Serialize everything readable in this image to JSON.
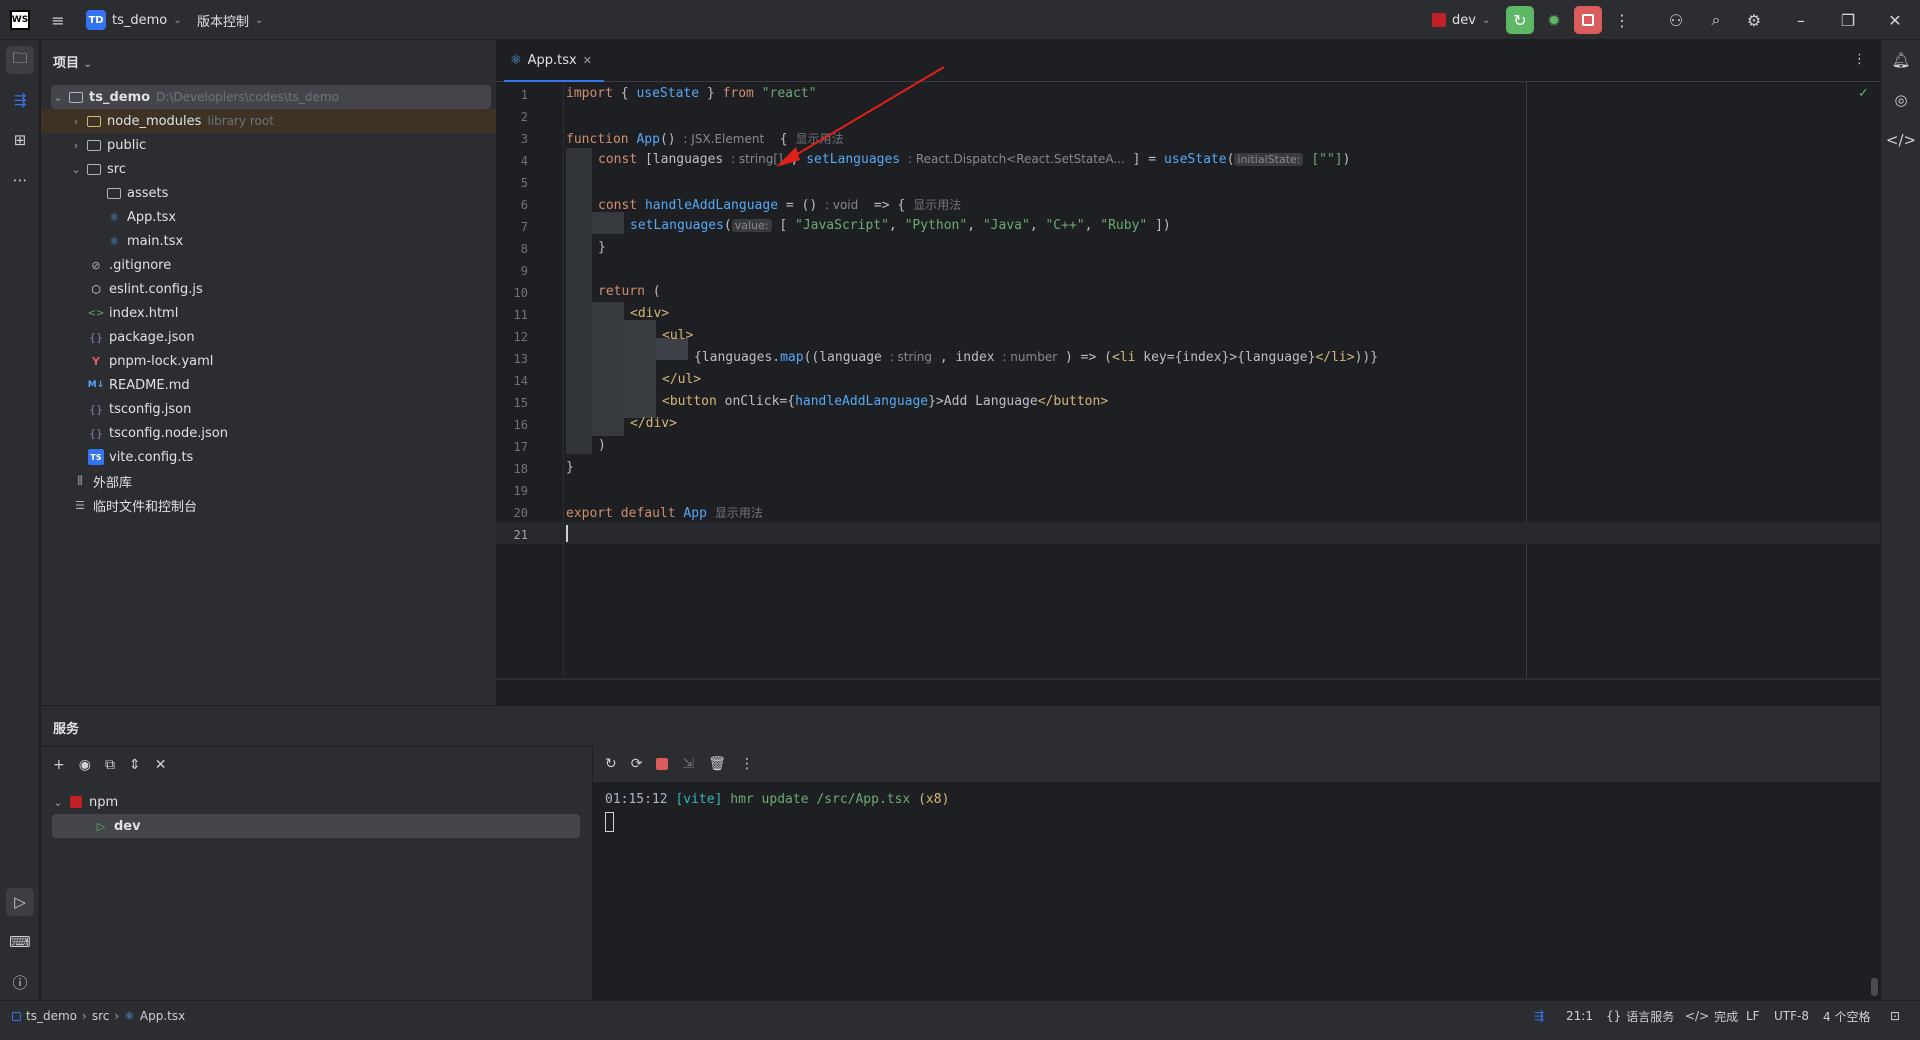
{
  "titlebar": {
    "logo": "WS",
    "menu_icon": "hamburger-icon",
    "project_badge": "TD",
    "project_name": "ts_demo",
    "vcs_label": "版本控制",
    "run_config": "dev"
  },
  "project_panel": {
    "title": "项目",
    "tree": [
      {
        "label": "ts_demo",
        "hint": "D:\\Developlers\\codes\\ts_demo",
        "icon": "folder-icon"
      },
      {
        "label": "node_modules",
        "hint": "library root",
        "icon": "folder-icon"
      },
      {
        "label": "public",
        "hint": "",
        "icon": "folder-icon"
      },
      {
        "label": "src",
        "hint": "",
        "icon": "folder-icon"
      },
      {
        "label": "assets",
        "hint": "",
        "icon": "folder-icon"
      },
      {
        "label": "App.tsx",
        "hint": "",
        "icon": "react-icon"
      },
      {
        "label": "main.tsx",
        "hint": "",
        "icon": "react-icon"
      },
      {
        "label": ".gitignore",
        "hint": "",
        "icon": "ignore-icon"
      },
      {
        "label": "eslint.config.js",
        "hint": "",
        "icon": "eslint-icon"
      },
      {
        "label": "index.html",
        "hint": "",
        "icon": "html-icon"
      },
      {
        "label": "package.json",
        "hint": "",
        "icon": "json-icon"
      },
      {
        "label": "pnpm-lock.yaml",
        "hint": "",
        "icon": "yaml-icon"
      },
      {
        "label": "README.md",
        "hint": "",
        "icon": "markdown-icon"
      },
      {
        "label": "tsconfig.json",
        "hint": "",
        "icon": "json-icon"
      },
      {
        "label": "tsconfig.node.json",
        "hint": "",
        "icon": "json-icon"
      },
      {
        "label": "vite.config.ts",
        "hint": "",
        "icon": "typescript-icon"
      },
      {
        "label": "外部库",
        "hint": "",
        "icon": "library-icon"
      },
      {
        "label": "临时文件和控制台",
        "hint": "",
        "icon": "scratch-icon"
      }
    ]
  },
  "editor": {
    "tab_label": "App.tsx",
    "line_numbers": [
      "1",
      "2",
      "3",
      "4",
      "5",
      "6",
      "7",
      "8",
      "9",
      "10",
      "11",
      "12",
      "13",
      "14",
      "15",
      "16",
      "17",
      "18",
      "19",
      "20",
      "21"
    ],
    "usage_hint": "显示用法",
    "inlays": {
      "jsx_element": ": JSX.Element",
      "string_arr": ": string[]",
      "dispatch": ": React.Dispatch<React.SetStateA...",
      "initial_state": "initialState:",
      "void": ": void",
      "value": "value:",
      "string": ": string",
      "number": ": number"
    },
    "code": {
      "l1_import": "import",
      "l1_brace_open": " { ",
      "l1_usestate": "useState",
      "l1_brace_close": " } ",
      "l1_from": "from",
      "l1_react": " \"react\"",
      "l3_function": "function",
      "l3_app": " App",
      "l3_parens": "()",
      "l3_brace": "  {",
      "l4_const": "const",
      "l4_languages": " [languages",
      "l4_comma": " , ",
      "l4_setlanguages": "setLanguages",
      "l4_eq": " ] = ",
      "l4_usestate": "useState",
      "l4_paren": "(",
      "l4_empty": "[\"\"]",
      "l4_close": ")",
      "l6_const": "const",
      "l6_handler": " handleAddLanguage",
      "l6_eq": " = ()",
      "l6_arrow": "  => {",
      "l7_set": "setLanguages",
      "l7_paren": "(",
      "l7_open": " [ ",
      "l7_js": "\"JavaScript\"",
      "l7_py": "\"Python\"",
      "l7_java": "\"Java\"",
      "l7_cpp": "\"C++\"",
      "l7_ruby": "\"Ruby\"",
      "l7_comma": ", ",
      "l7_close": " ])",
      "l8_close": "}",
      "l10_return": "return",
      "l10_paren": " (",
      "l11_div": "<div>",
      "l12_ul": "<ul>",
      "l13_a": "{languages.",
      "l13_map": "map",
      "l13_b": "((language",
      "l13_c": " , index",
      "l13_d": " ) => (",
      "l13_li_open": "<li",
      "l13_e": " key={index}>{language}",
      "l13_li_close": "</li>",
      "l13_f": "))}",
      "l14_ul_close": "</ul>",
      "l15_button_open": "<button",
      "l15_onclick": " onClick={",
      "l15_handler": "handleAddLanguage",
      "l15_text": "}>Add Language",
      "l15_button_close": "</button>",
      "l16_div_close": "</div>",
      "l17_paren": ")",
      "l18_brace": "}",
      "l20_export": "export",
      "l20_default": " default",
      "l20_app": " App"
    }
  },
  "services": {
    "title": "服务",
    "tree": [
      {
        "label": "npm"
      },
      {
        "label": "dev"
      }
    ],
    "console": {
      "time": "01:15:12",
      "tag": "[vite]",
      "msg": " hmr update /src/App.tsx",
      "count": " (x8)"
    }
  },
  "statusbar": {
    "breadcrumb": [
      "ts_demo",
      "src",
      "App.tsx"
    ],
    "position": "21:1",
    "lang_service": "语言服务",
    "done": "完成",
    "line_sep": "LF",
    "encoding": "UTF-8",
    "indent": "4 个空格"
  },
  "colors": {
    "accent": "#3574f0",
    "run_green": "#5fb865",
    "stop_red": "#db5c5c",
    "keyword": "#cf8e6d",
    "function": "#56a8f5",
    "string": "#6aab73",
    "tag": "#d5b778"
  }
}
